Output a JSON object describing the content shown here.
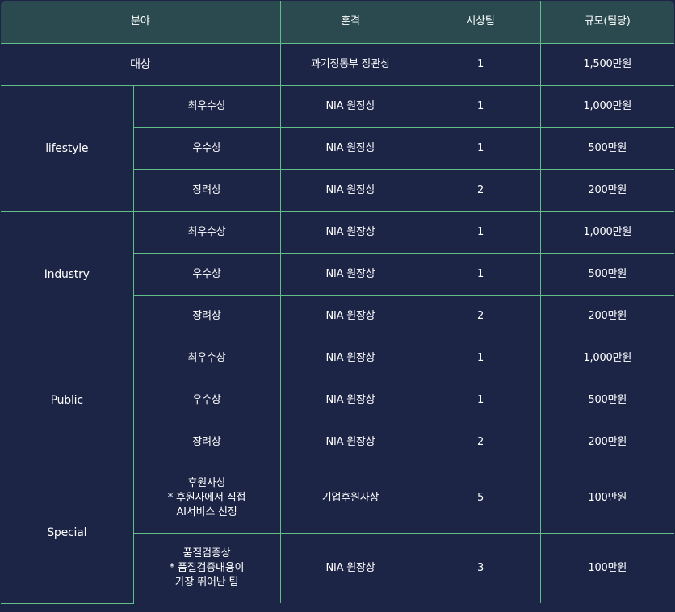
{
  "headers": [
    "분야",
    "훈격",
    "시상팀",
    "규모(팀당)"
  ],
  "grand": {
    "label": "대상",
    "award": "과기정통부 장관상",
    "teams": "1",
    "prize": "1,500만원"
  },
  "categories": [
    {
      "name": "lifestyle",
      "rows": [
        {
          "tier": "최우수상",
          "award": "NIA 원장상",
          "teams": "1",
          "prize": "1,000만원"
        },
        {
          "tier": "우수상",
          "award": "NIA 원장상",
          "teams": "1",
          "prize": "500만원"
        },
        {
          "tier": "장려상",
          "award": "NIA 원장상",
          "teams": "2",
          "prize": "200만원"
        }
      ]
    },
    {
      "name": "Industry",
      "rows": [
        {
          "tier": "최우수상",
          "award": "NIA 원장상",
          "teams": "1",
          "prize": "1,000만원"
        },
        {
          "tier": "우수상",
          "award": "NIA 원장상",
          "teams": "1",
          "prize": "500만원"
        },
        {
          "tier": "장려상",
          "award": "NIA 원장상",
          "teams": "2",
          "prize": "200만원"
        }
      ]
    },
    {
      "name": "Public",
      "rows": [
        {
          "tier": "최우수상",
          "award": "NIA 원장상",
          "teams": "1",
          "prize": "1,000만원"
        },
        {
          "tier": "우수상",
          "award": "NIA 원장상",
          "teams": "1",
          "prize": "500만원"
        },
        {
          "tier": "장려상",
          "award": "NIA 원장상",
          "teams": "2",
          "prize": "200만원"
        }
      ]
    },
    {
      "name": "Special",
      "rows": [
        {
          "tier": "후원사상\n* 후원사에서 직접\nAI서비스 선정",
          "award": "기업후원사상",
          "teams": "5",
          "prize": "100만원"
        },
        {
          "tier": "품질검증상\n* 품질검증내용이\n가장 뛰어난 팀",
          "award": "NIA 원장상",
          "teams": "3",
          "prize": "100만원"
        }
      ]
    }
  ]
}
